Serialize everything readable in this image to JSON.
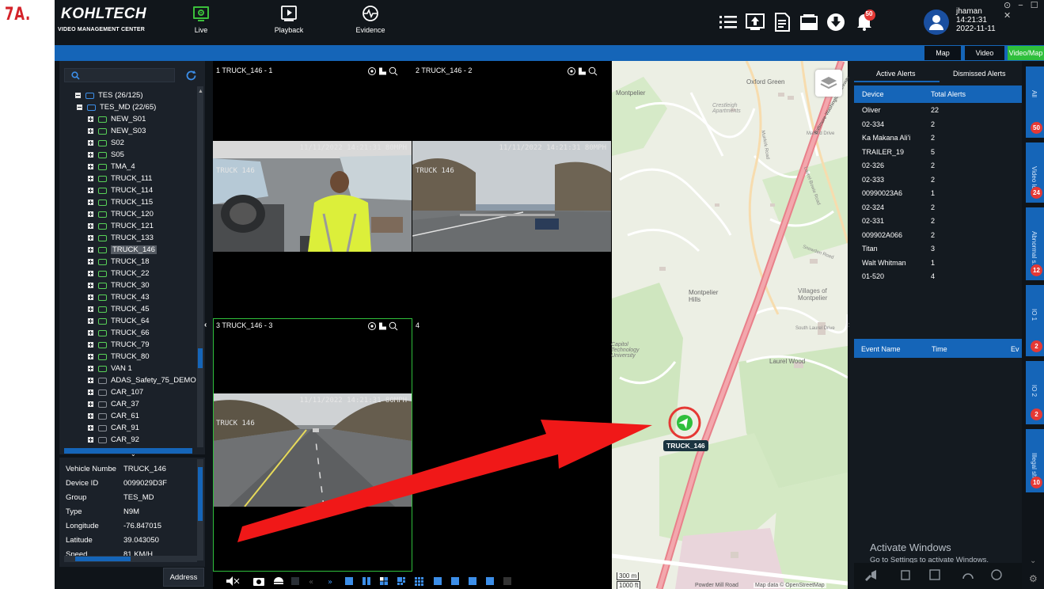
{
  "figure_label": "7A.",
  "app": {
    "logo": "KOHLTECH",
    "logo_sub": "VIDEO MANAGEMENT CENTER"
  },
  "nav": [
    {
      "label": "Live",
      "icon": "live-icon"
    },
    {
      "label": "Playback",
      "icon": "playback-icon"
    },
    {
      "label": "Evidence",
      "icon": "evidence-icon"
    }
  ],
  "notifications_count": "50",
  "user": {
    "name": "jhaman",
    "time": "14:21:31",
    "date": "2022-11-11"
  },
  "view_tabs": [
    "Map",
    "Video",
    "Video/Map"
  ],
  "tree": {
    "root": "TES (26/125)",
    "group": "TES_MD (22/65)",
    "items": [
      "NEW_S01",
      "NEW_S03",
      "S02",
      "S05",
      "TMA_4",
      "TRUCK_111",
      "TRUCK_114",
      "TRUCK_115",
      "TRUCK_120",
      "TRUCK_121",
      "TRUCK_133",
      "TRUCK_146",
      "TRUCK_18",
      "TRUCK_22",
      "TRUCK_30",
      "TRUCK_43",
      "TRUCK_45",
      "TRUCK_64",
      "TRUCK_66",
      "TRUCK_79",
      "TRUCK_80",
      "VAN 1",
      "ADAS_Safety_75_DEMO",
      "CAR_107",
      "CAR_37",
      "CAR_61",
      "CAR_91",
      "CAR_92"
    ]
  },
  "vehicle_info": {
    "rows": [
      {
        "k": "Vehicle Numbe",
        "v": "TRUCK_146"
      },
      {
        "k": "Device ID",
        "v": "0099029D3F"
      },
      {
        "k": "Group",
        "v": "TES_MD"
      },
      {
        "k": "Type",
        "v": "N9M"
      },
      {
        "k": "Longitude",
        "v": "-76.847015"
      },
      {
        "k": "Latitude",
        "v": "39.043050"
      },
      {
        "k": "Speed",
        "v": "81 KM/H"
      }
    ],
    "address_button": "Address"
  },
  "video": {
    "slot1_title": "1 TRUCK_146 - 1",
    "slot2_title": "2 TRUCK_146 - 2",
    "slot3_title": "3 TRUCK_146 - 3",
    "slot4_title": "4",
    "slot1_ts": "11/11/2022 14:21:31   80MPH",
    "slot2_ts": "11/11/2022 14:21:31   80MPH",
    "slot3_ts": "11/11/2022 14:21:31   80MPH",
    "cam_label": "TRUCK 146"
  },
  "map": {
    "marker_label": "TRUCK_146",
    "labels": {
      "oxford": "Oxford Green",
      "montpelier": "Montpelier",
      "crestleigh": "Crestleigh Apartments",
      "montpelier_hills": "Montpelier Hills",
      "villages": "Villages of Montpelier",
      "capitol": "Capitol Technology University",
      "laurel_wood": "Laurel Wood",
      "mallard": "Mallard Drive",
      "snowden": "Snowden Road",
      "south_laurel": "South Laurel Drive",
      "laurel_bowie": "Laurel-Bowie Road",
      "baltimore": "Baltimore-Washington Parkway",
      "muirkirk": "Muirkirk Road",
      "powder": "Powder Mill Road",
      "attribution": "Map data © OpenStreetMap"
    },
    "scale": {
      "m": "300 m",
      "ft": "1000 ft"
    }
  },
  "alerts": {
    "tabs": [
      "Active Alerts",
      "Dismissed Alerts"
    ],
    "headers": [
      "Device",
      "Total Alerts"
    ],
    "rows": [
      {
        "device": "Oliver",
        "total": "22"
      },
      {
        "device": "02-334",
        "total": "2"
      },
      {
        "device": "Ka Makana Ali'i",
        "total": "2"
      },
      {
        "device": "TRAILER_19",
        "total": "5"
      },
      {
        "device": "02-326",
        "total": "2"
      },
      {
        "device": "02-333",
        "total": "2"
      },
      {
        "device": "00990023A6",
        "total": "1"
      },
      {
        "device": "02-324",
        "total": "2"
      },
      {
        "device": "02-331",
        "total": "2"
      },
      {
        "device": "009902A066",
        "total": "2"
      },
      {
        "device": "Titan",
        "total": "3"
      },
      {
        "device": "Walt Whitman",
        "total": "1"
      },
      {
        "device": "01-520",
        "total": "4"
      }
    ],
    "event_headers": [
      "Event Name",
      "Time",
      "Ev"
    ]
  },
  "side_tabs": [
    {
      "label": "All",
      "count": "50"
    },
    {
      "label": "Video loss",
      "count": "24"
    },
    {
      "label": "Abnormal s.",
      "count": "12"
    },
    {
      "label": "IO 1",
      "count": "2"
    },
    {
      "label": "IO 2",
      "count": "2"
    },
    {
      "label": "Illegal sh..",
      "count": "10"
    }
  ],
  "watermark": {
    "line1": "Activate Windows",
    "line2": "Go to Settings to activate Windows."
  },
  "colors": {
    "accent": "#1565b8",
    "green": "#2fbf3c",
    "alert_red": "#e53935",
    "arrow_red": "#f01818"
  }
}
